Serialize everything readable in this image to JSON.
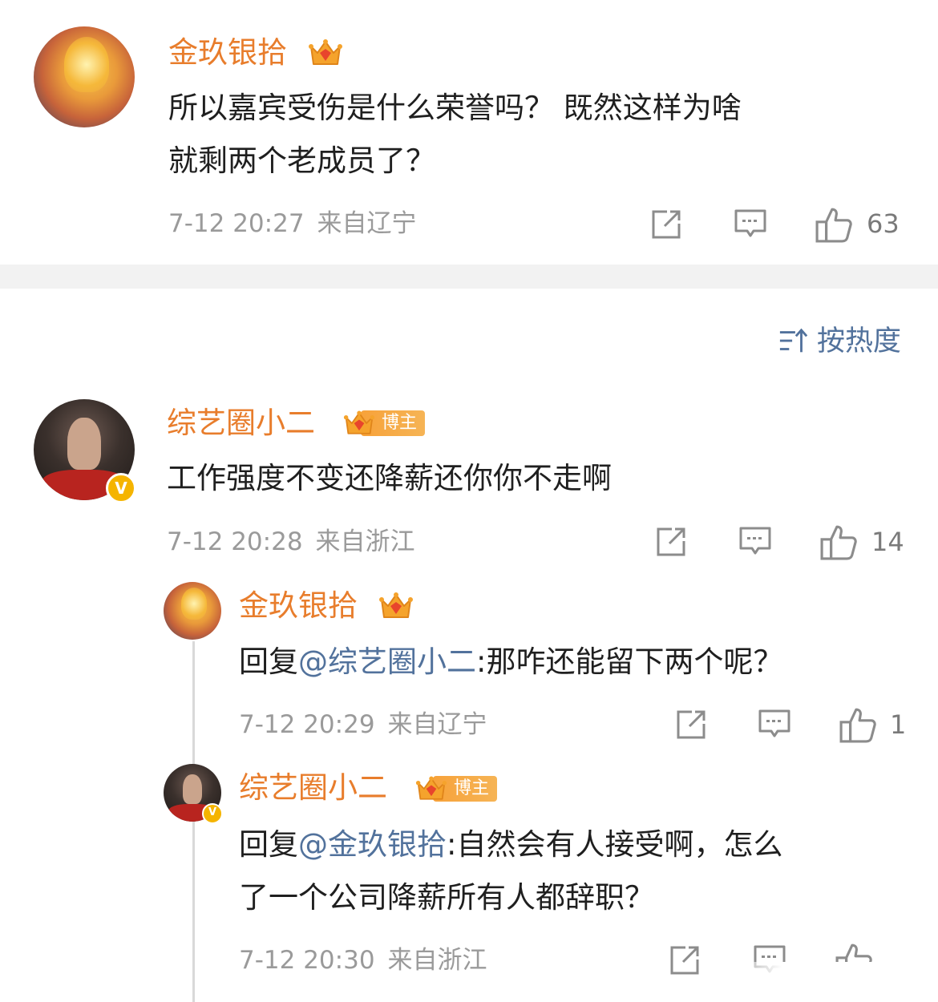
{
  "comments": [
    {
      "username": "金玖银拾",
      "text_line1": "所以嘉宾受伤是什么荣誉吗？ 既然这样为啥",
      "text_line2": "就剩两个老成员了？",
      "time": "7-12 20:27",
      "location": "来自辽宁",
      "likes": "63"
    },
    {
      "username": "综艺圈小二",
      "badge": "博主",
      "text": "工作强度不变还降薪还你你不走啊",
      "time": "7-12 20:28",
      "location": "来自浙江",
      "likes": "14",
      "replies": [
        {
          "username": "金玖银拾",
          "reply_prefix": "回复",
          "mention": "@综艺圈小二",
          "text": ":那咋还能留下两个呢？",
          "time": "7-12 20:29",
          "location": "来自辽宁",
          "likes": "1"
        },
        {
          "username": "综艺圈小二",
          "badge": "博主",
          "reply_prefix": "回复",
          "mention": "@金玖银拾",
          "text_line1": ":自然会有人接受啊，怎么",
          "text_line2": "了一个公司降薪所有人都辞职？",
          "time": "7-12 20:30",
          "location": "来自浙江"
        }
      ]
    }
  ],
  "sort": {
    "label": "按热度"
  },
  "icons": {
    "share": "share-icon",
    "comment": "comment-icon",
    "like": "like-icon",
    "crown": "crown-icon",
    "verified": "verified-icon"
  },
  "colors": {
    "username": "#e87d2c",
    "mention": "#52729c",
    "meta": "#9a9a9a",
    "badge": "#f5a83a",
    "verified": "#f5b400"
  },
  "verified_mark": "V"
}
